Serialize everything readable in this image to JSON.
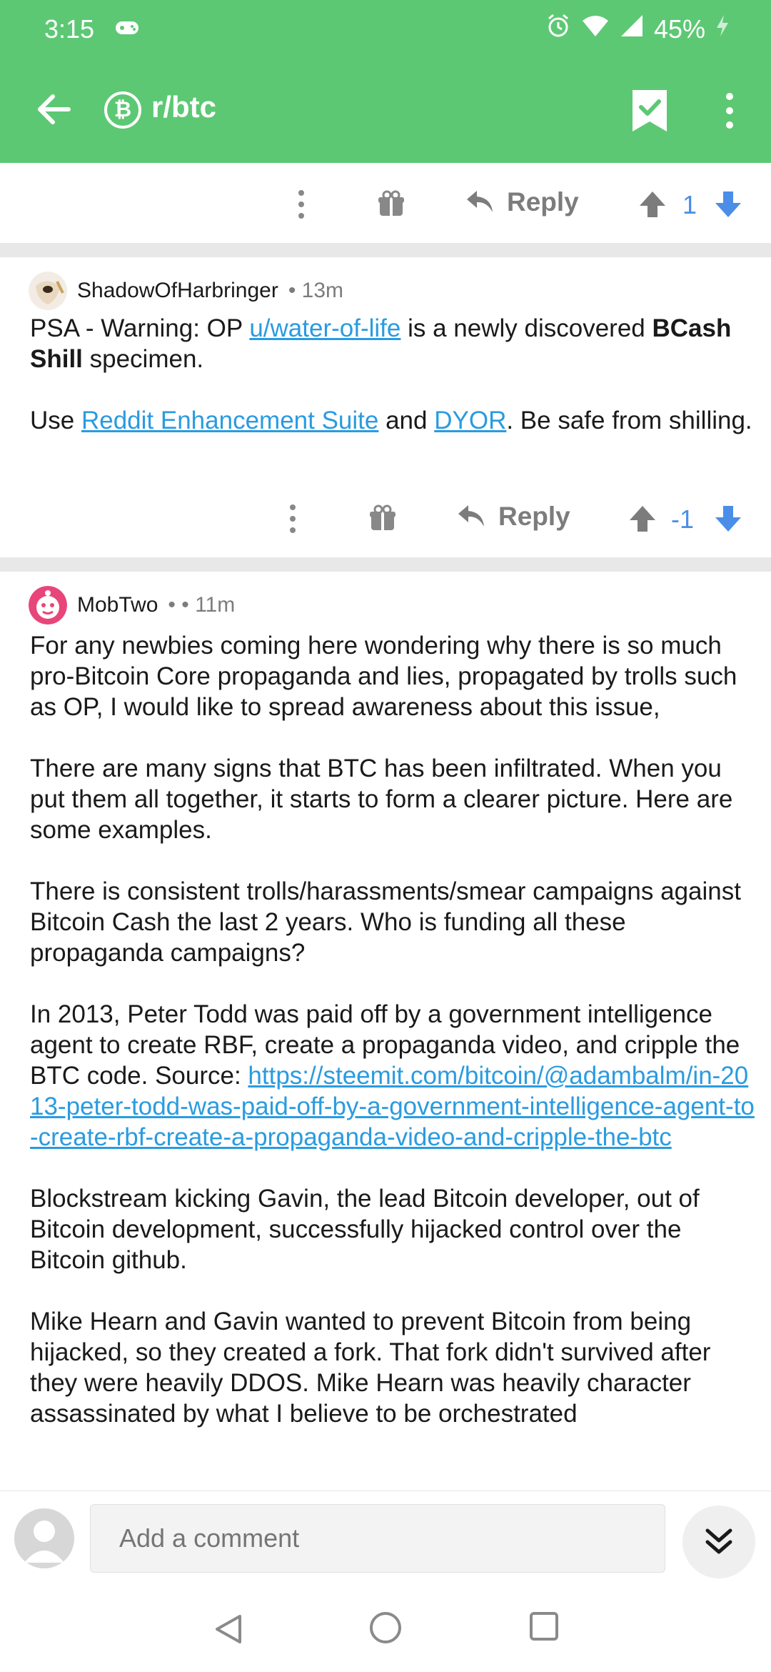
{
  "status_bar": {
    "time": "3:15",
    "battery": "45%"
  },
  "app_bar": {
    "subreddit": "r/btc",
    "sub_icon_glyph": "₿"
  },
  "top_actions": {
    "reply_label": "Reply",
    "score": "1"
  },
  "comment1": {
    "author": "ShadowOfHarbringer",
    "time": "• 13m",
    "p1_a": "PSA - Warning: OP ",
    "p1_link": "u/water-of-life",
    "p1_b": " is a newly discovered ",
    "p1_bold": "BCash Shill",
    "p1_c": " specimen.",
    "p2_a": "Use ",
    "p2_link1": "Reddit Enhancement Suite",
    "p2_b": " and ",
    "p2_link2": "DYOR",
    "p2_c": ". Be safe from shilling.",
    "reply_label": "Reply",
    "score": "-1"
  },
  "comment2": {
    "author": "MobTwo",
    "time": "• • 11m",
    "p1": "For any newbies coming here wondering why there is so much pro-Bitcoin Core propaganda and lies, propagated by trolls such as OP, I would like to spread awareness about this issue,",
    "p2": "There are many signs that BTC has been infiltrated. When you put them all together, it starts to form a clearer picture. Here are some examples.",
    "p3": "There is consistent trolls/harassments/smear campaigns against Bitcoin Cash the last 2 years. Who is funding all these propaganda campaigns?",
    "p4_a": "In 2013, Peter Todd was paid off by a government intelligence agent to create RBF, create a propaganda video, and cripple the BTC code. Source: ",
    "p4_link": "https://steemit.com/bitcoin/@adambalm/in-2013-peter-todd-was-paid-off-by-a-government-intelligence-agent-to-create-rbf-create-a-propaganda-video-and-cripple-the-btc",
    "p5": "Blockstream kicking Gavin, the lead Bitcoin developer, out of Bitcoin development, successfully hijacked control over the Bitcoin github.",
    "p6": "Mike Hearn and Gavin wanted to prevent Bitcoin from being hijacked, so they created a fork. That fork didn't survived after they were heavily DDOS. Mike Hearn was heavily character assassinated by what I believe to be orchestrated"
  },
  "comment_bar": {
    "placeholder": "Add a comment"
  },
  "colors": {
    "brand_green": "#5dc874",
    "link_blue": "#2a9be0",
    "vote_blue": "#4a8ee8"
  },
  "icons": [
    "back-arrow-icon",
    "bitcoin-icon",
    "saved-check-icon",
    "more-vert-icon",
    "gift-icon",
    "reply-icon",
    "upvote-icon",
    "downvote-icon",
    "user-avatar-icon",
    "chevron-double-down-icon",
    "nav-back-icon",
    "nav-home-icon",
    "nav-recent-icon"
  ]
}
